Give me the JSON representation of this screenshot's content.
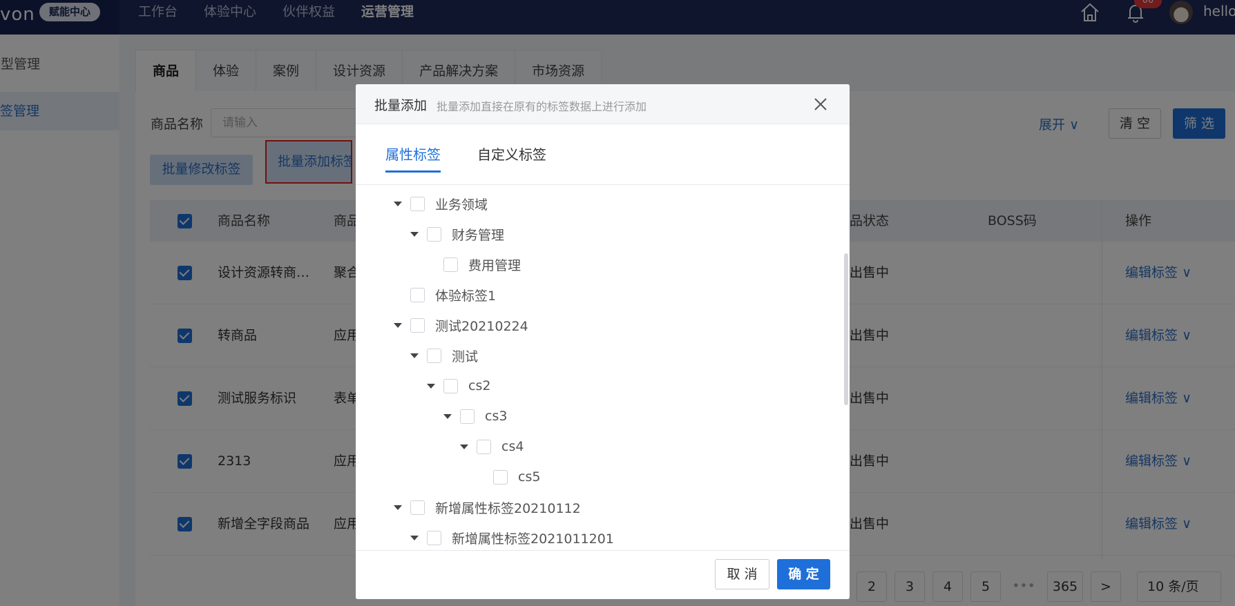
{
  "header": {
    "logo_text": "von",
    "logo_badge": "赋能中心",
    "nav": [
      "工作台",
      "体验中心",
      "伙伴权益",
      "运营管理"
    ],
    "active_nav": "运营管理",
    "notification_count": "00",
    "username": "hello"
  },
  "sidebar": {
    "items": [
      {
        "label": "类型管理"
      },
      {
        "label": "签管理"
      }
    ]
  },
  "main": {
    "tabs": [
      "商品",
      "体验",
      "案例",
      "设计资源",
      "产品解决方案",
      "市场资源"
    ],
    "filter": {
      "label": "商品名称",
      "placeholder": "请输入"
    },
    "expand_label": "展开",
    "clear_label": "清 空",
    "filter_label": "筛 选",
    "batch_modify_label": "批量修改标签",
    "batch_add_label": "批量添加标签",
    "table": {
      "headers": {
        "name": "商品名称",
        "type": "商品",
        "status": "品状态",
        "boss": "BOSS码",
        "op": "操作"
      },
      "rows": [
        {
          "name": "设计资源转商…",
          "type": "聚合",
          "status": "出售中",
          "op": "编辑标签"
        },
        {
          "name": "转商品",
          "type": "应用",
          "status": "出售中",
          "op": "编辑标签"
        },
        {
          "name": "测试服务标识",
          "type": "表单",
          "status": "出售中",
          "op": "编辑标签"
        },
        {
          "name": "2313",
          "type": "应用",
          "status": "出售中",
          "op": "编辑标签"
        },
        {
          "name": "新增全字段商品",
          "type": "应用",
          "status": "出售中",
          "op": "编辑标签"
        }
      ]
    },
    "pagination": {
      "pages": [
        "2",
        "3",
        "4",
        "5"
      ],
      "ellipsis": "•••",
      "last_page": "365",
      "next": ">",
      "page_size": "10 条/页"
    }
  },
  "modal": {
    "title": "批量添加",
    "subtitle": "批量添加直接在原有的标签数据上进行添加",
    "tabs": [
      "属性标签",
      "自定义标签"
    ],
    "active_tab": "属性标签",
    "tree": [
      {
        "label": "业务领域",
        "expanded": true
      },
      {
        "label": "财务管理",
        "expanded": true
      },
      {
        "label": "费用管理",
        "expanded": false
      },
      {
        "label": "体验标签1",
        "expanded": false
      },
      {
        "label": "测试20210224",
        "expanded": true
      },
      {
        "label": "测试",
        "expanded": true
      },
      {
        "label": "cs2",
        "expanded": true
      },
      {
        "label": "cs3",
        "expanded": true
      },
      {
        "label": "cs4",
        "expanded": true
      },
      {
        "label": "cs5",
        "expanded": false
      },
      {
        "label": "新增属性标签20210112",
        "expanded": true
      },
      {
        "label": "新增属性标签2021011201",
        "expanded": true
      }
    ],
    "cancel_label": "取 消",
    "ok_label": "确 定"
  },
  "colors": {
    "primary": "#1e6fd9",
    "header_bg": "#1c2a5a",
    "highlight_border": "#e02020"
  }
}
